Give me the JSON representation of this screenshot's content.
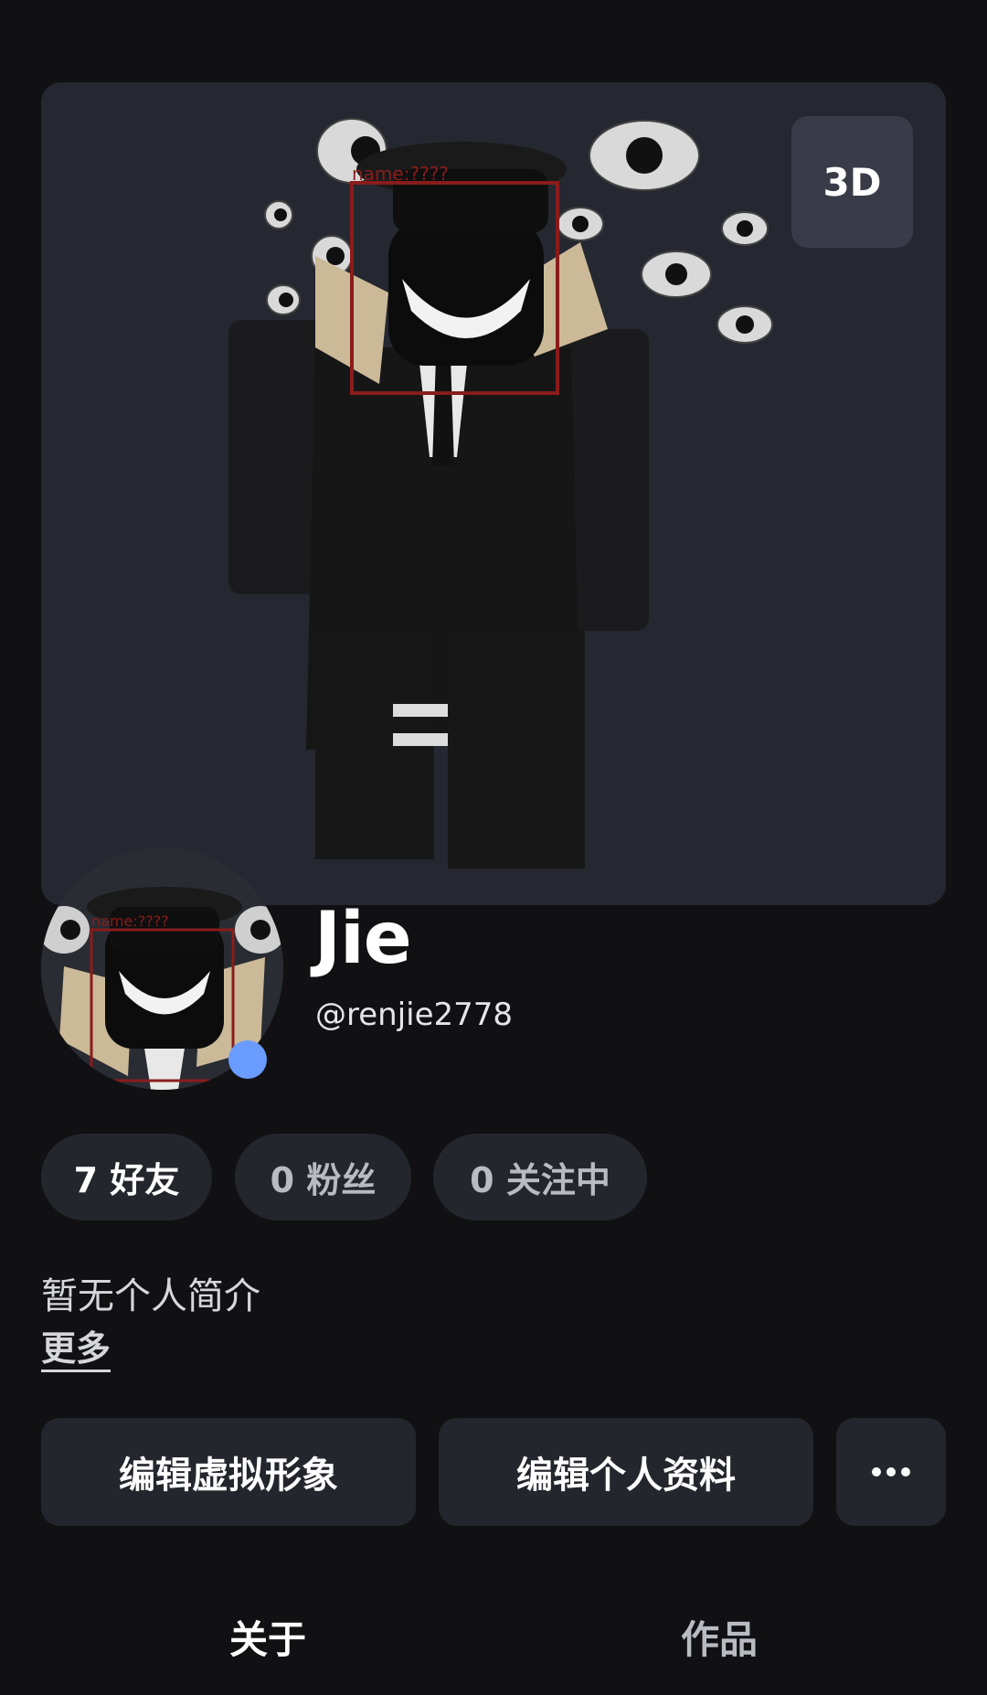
{
  "hero": {
    "view_toggle_label": "3D",
    "overlay_label": "name:????"
  },
  "profile": {
    "display_name": "Jie",
    "username": "@renjie2778",
    "status": "online",
    "status_color": "#6a9bff"
  },
  "stats": {
    "friends": "7 好友",
    "followers": "0 粉丝",
    "following": "0 关注中"
  },
  "bio": {
    "text": "暂无个人简介",
    "more_label": "更多"
  },
  "actions": {
    "edit_avatar": "编辑虚拟形象",
    "edit_profile": "编辑个人资料",
    "more_icon": "ellipsis-icon"
  },
  "tabs": [
    {
      "label": "关于",
      "active": true
    },
    {
      "label": "作品",
      "active": false
    }
  ]
}
